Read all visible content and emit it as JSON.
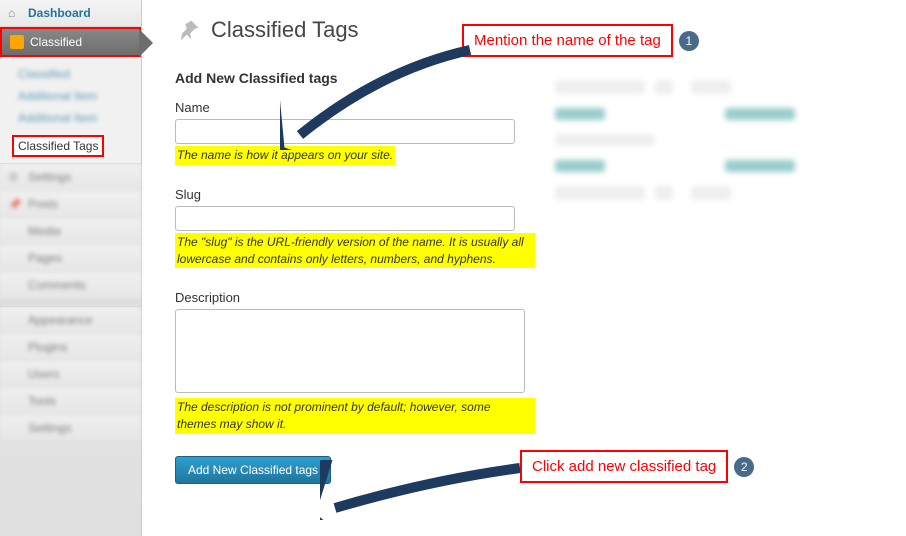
{
  "sidebar": {
    "dashboard": "Dashboard",
    "classified": "Classified",
    "classified_tags_sub": "Classified Tags",
    "blurred_items_top": [
      "Classified",
      "Additional Item",
      "Additional Item"
    ],
    "blurred_items": [
      "Settings",
      "Posts",
      "Media",
      "Pages",
      "Comments"
    ],
    "blurred_items_2": [
      "Appearance",
      "Plugins",
      "Users",
      "Tools",
      "Settings"
    ]
  },
  "page": {
    "title": "Classified Tags"
  },
  "form": {
    "heading": "Add New Classified tags",
    "name_label": "Name",
    "name_help": "The name is how it appears on your site.",
    "slug_label": "Slug",
    "slug_help": "The \"slug\" is the URL-friendly version of the name. It is usually all lowercase and contains only letters, numbers, and hyphens.",
    "desc_label": "Description",
    "desc_help": "The description is not prominent by default; however, some themes may show it.",
    "submit": "Add New Classified tags"
  },
  "callouts": {
    "c1": "Mention the name of the tag",
    "c2": "Click add new classified tag",
    "b1": "1",
    "b2": "2"
  }
}
